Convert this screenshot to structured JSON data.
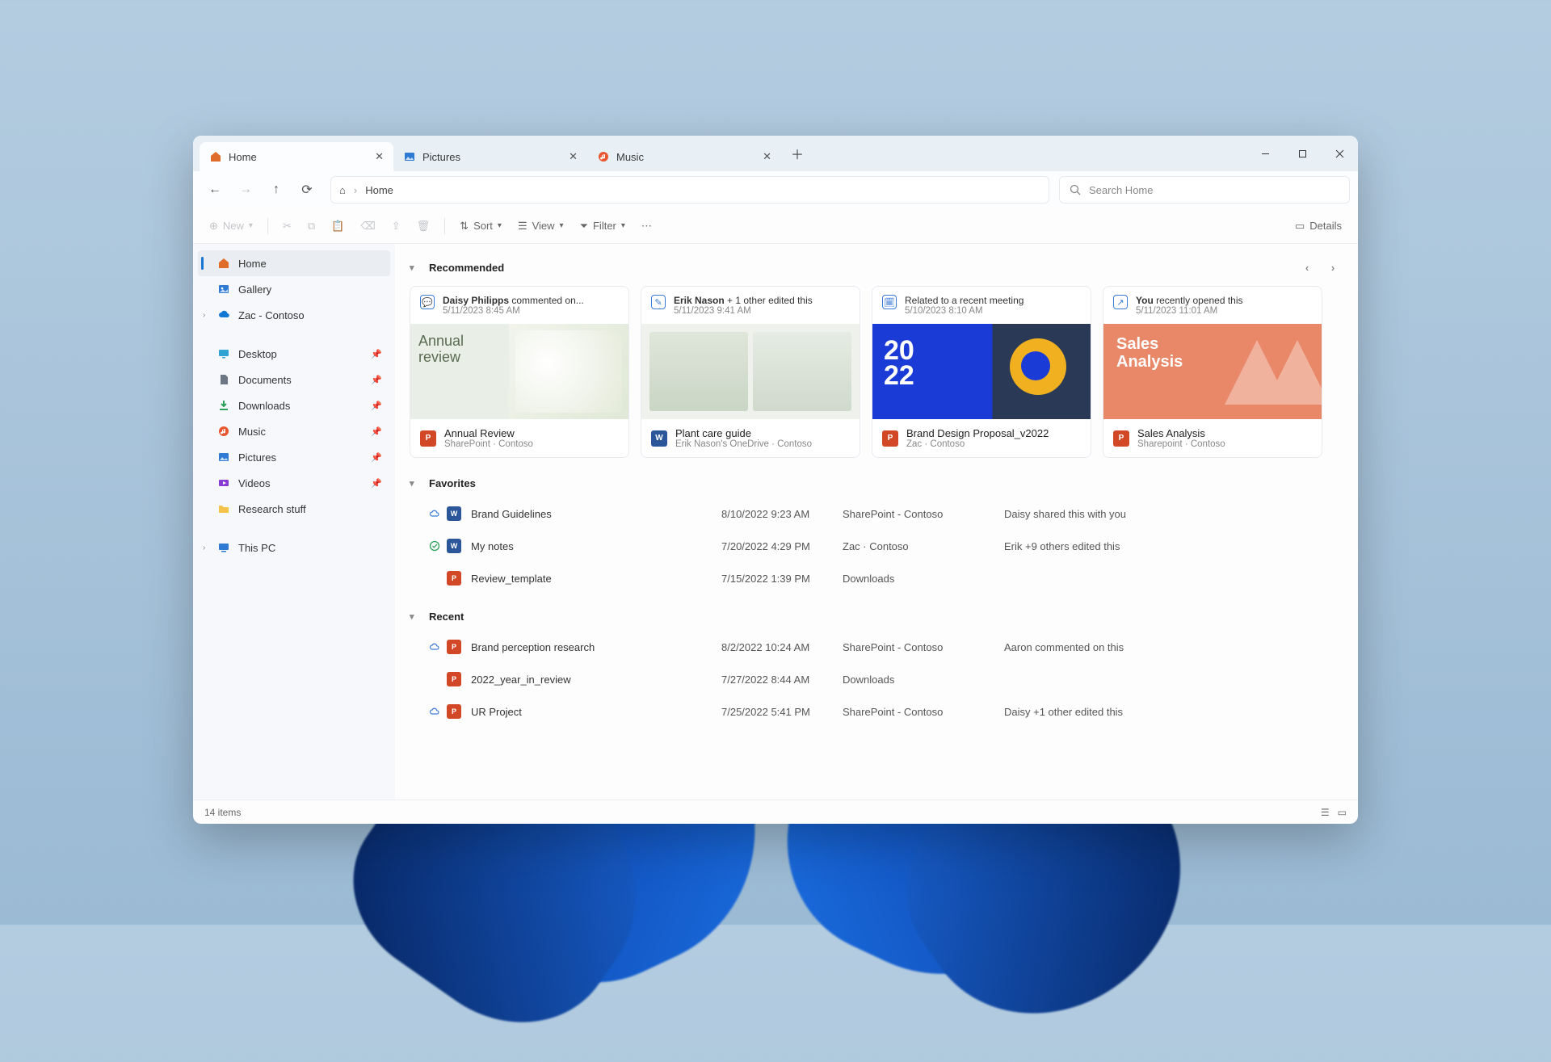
{
  "tabs": [
    {
      "label": "Home",
      "icon": "home",
      "color": "#e06c2b",
      "active": true
    },
    {
      "label": "Pictures",
      "icon": "pictures",
      "color": "#2f7bd4",
      "active": false
    },
    {
      "label": "Music",
      "icon": "music",
      "color": "#e8552f",
      "active": false
    }
  ],
  "address": {
    "crumb": "Home"
  },
  "search": {
    "placeholder": "Search Home"
  },
  "toolbar": {
    "new": "New",
    "sort": "Sort",
    "view": "View",
    "filter": "Filter",
    "details": "Details"
  },
  "sidebar": {
    "top": [
      {
        "label": "Home",
        "icon": "home",
        "color": "#e06c2b",
        "selected": true
      },
      {
        "label": "Gallery",
        "icon": "gallery",
        "color": "#2f7bd4"
      },
      {
        "label": "Zac - Contoso",
        "icon": "cloud",
        "color": "#1078d4",
        "expandable": true
      }
    ],
    "pinned": [
      {
        "label": "Desktop",
        "icon": "desktop",
        "color": "#2fa4d4"
      },
      {
        "label": "Documents",
        "icon": "documents",
        "color": "#6d7685"
      },
      {
        "label": "Downloads",
        "icon": "downloads",
        "color": "#2fa05a"
      },
      {
        "label": "Music",
        "icon": "music",
        "color": "#e8552f"
      },
      {
        "label": "Pictures",
        "icon": "pictures",
        "color": "#2f7bd4"
      },
      {
        "label": "Videos",
        "icon": "videos",
        "color": "#8a3bd6"
      },
      {
        "label": "Research stuff",
        "icon": "folder",
        "color": "#f3c34b",
        "pinned": false
      }
    ],
    "bottom": [
      {
        "label": "This PC",
        "icon": "pc",
        "color": "#2f7bd4",
        "expandable": true
      }
    ]
  },
  "recommended": {
    "title": "Recommended",
    "cards": [
      {
        "action_icon": "comment",
        "line1_bold": "Daisy Philipps",
        "line1_rest": " commented on...",
        "date": "5/11/2023 8:45 AM",
        "titleText": "Annual Review",
        "location": "SharePoint · Contoso",
        "file_kind": "ppt",
        "thumb": "annual"
      },
      {
        "action_icon": "edit",
        "line1_bold": "Erik Nason",
        "line1_rest": " + 1 other edited this",
        "date": "5/11/2023 9:41 AM",
        "titleText": "Plant care guide",
        "location": "Erik Nason's OneDrive · Contoso",
        "file_kind": "word",
        "thumb": "plant"
      },
      {
        "action_icon": "calendar",
        "line1_bold": "",
        "line1_rest": "Related to a recent meeting",
        "date": "5/10/2023 8:10 AM",
        "titleText": "Brand Design Proposal_v2022",
        "location": "Zac · Contoso",
        "file_kind": "ppt",
        "thumb": "brand"
      },
      {
        "action_icon": "open",
        "line1_bold": "You",
        "line1_rest": " recently opened this",
        "date": "5/11/2023 11:01 AM",
        "titleText": "Sales Analysis",
        "location": "Sharepoint · Contoso",
        "file_kind": "ppt",
        "thumb": "sales"
      }
    ]
  },
  "favorites": {
    "title": "Favorites",
    "rows": [
      {
        "status": "cloud",
        "kind": "word",
        "name": "Brand Guidelines",
        "date": "8/10/2022 9:23 AM",
        "loc": "SharePoint - Contoso",
        "act": "Daisy shared this with you"
      },
      {
        "status": "sync",
        "kind": "word",
        "name": "My notes",
        "date": "7/20/2022 4:29 PM",
        "loc": "Zac · Contoso",
        "act": "Erik +9 others edited this"
      },
      {
        "status": "",
        "kind": "ppt",
        "name": "Review_template",
        "date": "7/15/2022 1:39 PM",
        "loc": "Downloads",
        "act": ""
      }
    ]
  },
  "recent": {
    "title": "Recent",
    "rows": [
      {
        "status": "cloud",
        "kind": "ppt",
        "name": "Brand perception research",
        "date": "8/2/2022 10:24 AM",
        "loc": "SharePoint - Contoso",
        "act": "Aaron commented on this"
      },
      {
        "status": "",
        "kind": "ppt",
        "name": "2022_year_in_review",
        "date": "7/27/2022 8:44 AM",
        "loc": "Downloads",
        "act": ""
      },
      {
        "status": "cloud",
        "kind": "ppt",
        "name": "UR Project",
        "date": "7/25/2022 5:41 PM",
        "loc": "SharePoint - Contoso",
        "act": "Daisy +1 other edited this"
      }
    ]
  },
  "statusbar": {
    "text": "14 items"
  }
}
